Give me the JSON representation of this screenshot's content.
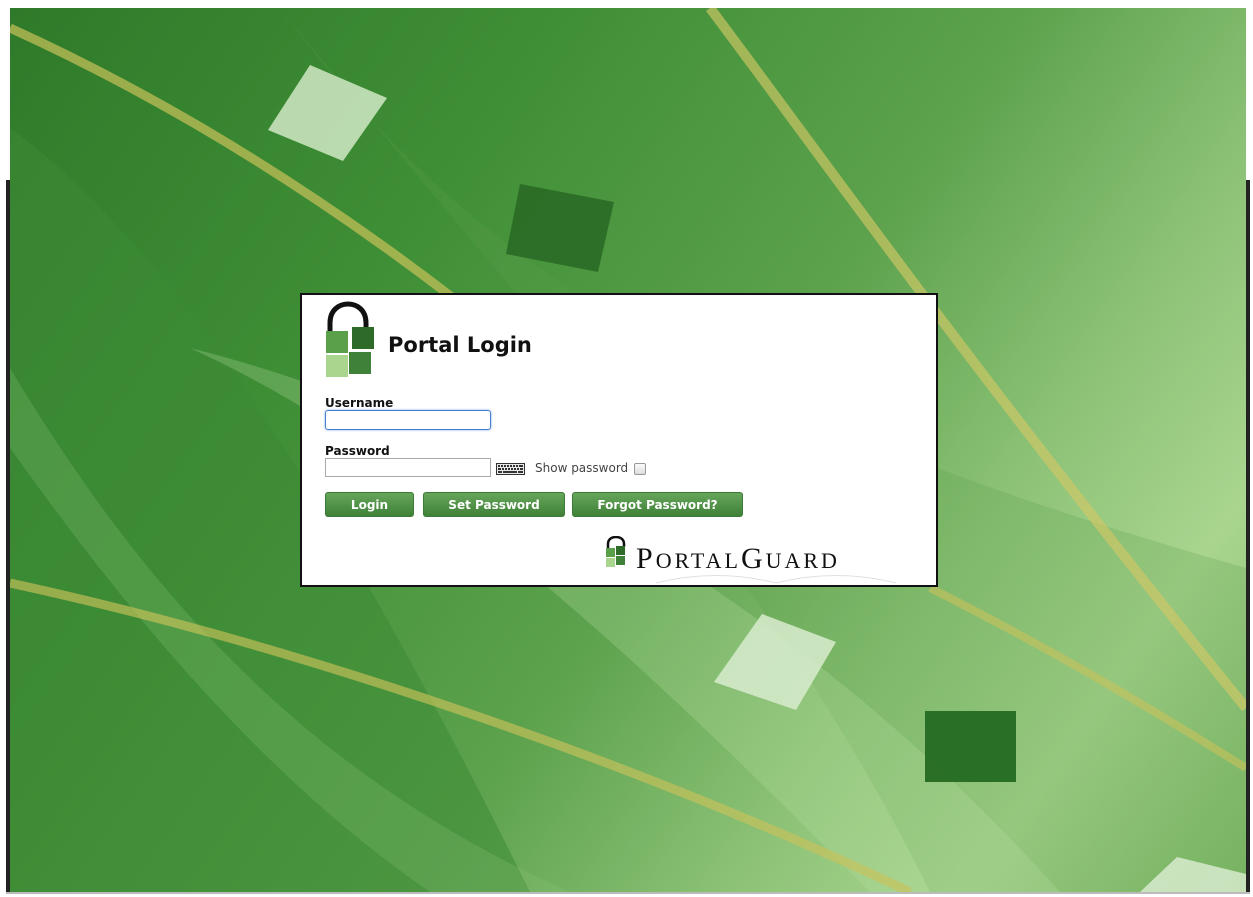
{
  "page": {
    "title": "Portal Login"
  },
  "form": {
    "username_label": "Username",
    "username_value": "",
    "password_label": "Password",
    "password_value": "",
    "show_password_label": "Show password",
    "show_password_checked": false
  },
  "buttons": {
    "login": "Login",
    "set_password": "Set Password",
    "forgot_password": "Forgot Password?"
  },
  "brand": {
    "name": "PortalGuard"
  },
  "icons": {
    "logo": "padlock-squares-icon",
    "keyboard": "keyboard-icon",
    "brand_logo": "portalguard-logo-icon"
  },
  "colors": {
    "button": "#4f9245",
    "panel_border": "#111111",
    "background": "#4a923f",
    "logo_dark": "#2e6b28",
    "logo_light": "#a9d58f"
  }
}
